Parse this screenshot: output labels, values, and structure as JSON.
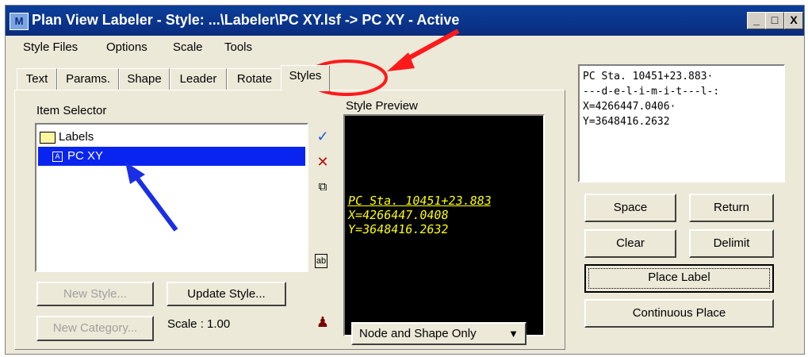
{
  "window": {
    "title": "Plan View Labeler - Style: ...\\Labeler\\PC XY.lsf -> PC XY - Active",
    "buttons": {
      "minimize": "_",
      "maximize": "□",
      "close": "X"
    }
  },
  "menu": [
    {
      "label": "Style Files"
    },
    {
      "label": "Options"
    },
    {
      "label": "Scale"
    },
    {
      "label": "Tools"
    }
  ],
  "tabs": [
    {
      "label": "Text"
    },
    {
      "label": "Params."
    },
    {
      "label": "Shape"
    },
    {
      "label": "Leader"
    },
    {
      "label": "Rotate"
    },
    {
      "label": "Styles",
      "active": true
    }
  ],
  "styles_panel": {
    "item_selector_label": "Item Selector",
    "tree": [
      {
        "label": "Labels",
        "icon": "folder-open-icon"
      },
      {
        "label": "PC XY",
        "icon": "style-item-icon",
        "selected": true
      }
    ],
    "tools": [
      {
        "icon": "checkmark-icon",
        "glyph": "✓"
      },
      {
        "icon": "delete-x-icon",
        "glyph": "✕"
      },
      {
        "icon": "copy-icon",
        "glyph": "⧉"
      },
      {
        "icon": "rename-icon",
        "glyph": "ab"
      },
      {
        "icon": "stamp-icon",
        "glyph": "♟"
      }
    ],
    "new_style_button": "New Style...",
    "update_style_button": "Update Style...",
    "new_category_button": "New Category...",
    "scale_text": "Scale : 1.00",
    "style_preview_label": "Style Preview",
    "preview_lines": [
      "PC Sta. 10451+23.883",
      "X=4266447.0408",
      "Y=3648416.2632"
    ],
    "preview_color": "#ffff00",
    "display_dropdown": "Node and Shape Only"
  },
  "text_editor": {
    "lines": [
      "PC Sta. 10451+23.883·",
      "---d-e-l-i-m-i-t---l-:",
      "X=4266447.0406·",
      "Y=3648416.2632"
    ]
  },
  "buttons": {
    "space": "Space",
    "return": "Return",
    "clear": "Clear",
    "delimit": "Delimit",
    "place_label": "Place Label",
    "continuous_place": "Continuous Place"
  },
  "annotations": {
    "highlight_color": "#ff1a1a",
    "pointer_color": "#1a2ee6"
  }
}
